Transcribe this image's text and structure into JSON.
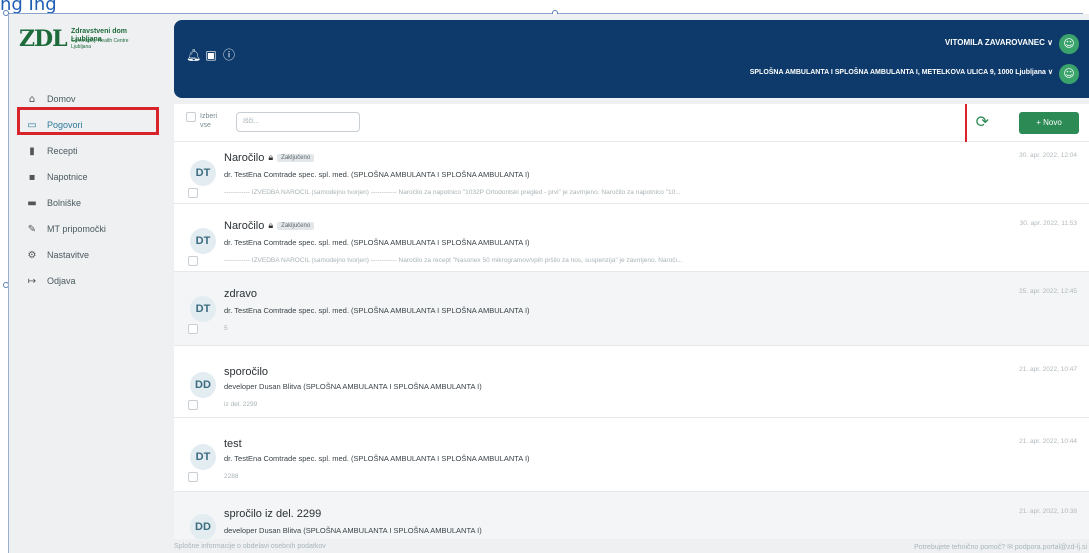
{
  "header_crop": {
    "text": "ng Ing"
  },
  "logo": {
    "mark": "ZDL",
    "name": "Zdravstveni dom Ljubljana",
    "sub": "Community Health Centre Ljubljana"
  },
  "sidebar": {
    "items": [
      {
        "label": "Domov",
        "icon": "home-icon"
      },
      {
        "label": "Pogovori",
        "icon": "chat-icon"
      },
      {
        "label": "Recepti",
        "icon": "prescription-icon"
      },
      {
        "label": "Napotnice",
        "icon": "referral-icon"
      },
      {
        "label": "Bolniške",
        "icon": "bed-icon"
      },
      {
        "label": "MT pripomočki",
        "icon": "tool-icon"
      },
      {
        "label": "Nastavitve",
        "icon": "gear-icon"
      },
      {
        "label": "Odjava",
        "icon": "logout-icon"
      }
    ]
  },
  "topbar": {
    "user": "VITOMILA ZAVAROVANEC ∨",
    "location": "SPLOŠNA AMBULANTA I SPLOŠNA AMBULANTA I, METELKOVA ULICA 9, 1000 Ljubljana ∨"
  },
  "toolbar": {
    "select_all": "Izberi vse",
    "search_placeholder": "Išči...",
    "new_label": "+ Novo"
  },
  "messages": [
    {
      "initials": "DT",
      "title": "Naročilo",
      "locked": true,
      "badge": "Zaključeno",
      "sender": "dr. TestEna Comtrade spec. spl. med. (SPLOŠNA AMBULANTA I SPLOŠNA AMBULANTA I)",
      "preview": "------------ IZVEDBA NAROČIL (samodejno tvorjen) ------------ Naročilo za napotnico \"1032P Ortodontski pregled - prvi\" je zavrnjeno. Naročilo za napotnico \"10...",
      "date": "30. apr. 2022, 12:04"
    },
    {
      "initials": "DT",
      "title": "Naročilo",
      "locked": true,
      "badge": "Zaključeno",
      "sender": "dr. TestEna Comtrade spec. spl. med. (SPLOŠNA AMBULANTA I SPLOŠNA AMBULANTA I)",
      "preview": "------------ IZVEDBA NAROČIL (samodejno tvorjen) ------------ Naročilo za recept \"Nasonex 50 mikrogramov/vpih pršilo za nos, suspenzija\" je zavrnjeno. Naroči...",
      "date": "30. apr. 2022, 11:53"
    },
    {
      "initials": "DT",
      "title": "zdravo",
      "locked": false,
      "badge": "",
      "sender": "dr. TestEna Comtrade spec. spl. med. (SPLOŠNA AMBULANTA I SPLOŠNA AMBULANTA I)",
      "preview": "5",
      "date": "25. apr. 2022, 12:45"
    },
    {
      "initials": "DD",
      "title": "sporočilo",
      "locked": false,
      "badge": "",
      "sender": "developer Dusan Blitva (SPLOŠNA AMBULANTA I SPLOŠNA AMBULANTA I)",
      "preview": "iz del. 2299",
      "date": "21. apr. 2022, 10:47"
    },
    {
      "initials": "DT",
      "title": "test",
      "locked": false,
      "badge": "",
      "sender": "dr. TestEna Comtrade spec. spl. med. (SPLOŠNA AMBULANTA I SPLOŠNA AMBULANTA I)",
      "preview": "2288",
      "date": "21. apr. 2022, 10:44"
    },
    {
      "initials": "DD",
      "title": "spročilo iz del. 2299",
      "locked": false,
      "badge": "",
      "sender": "developer Dusan Blitva (SPLOŠNA AMBULANTA I SPLOŠNA AMBULANTA I)",
      "preview": "",
      "date": "21. apr. 2022, 10:38"
    }
  ],
  "footer": {
    "left": "Splošne informacije o obdelavi osebnih podatkov",
    "right": "Potrebujete tehnično pomoč? ✉ podpora.portal@zd-lj.si"
  },
  "colors": {
    "navy": "#0d3a6a",
    "green": "#2c8a55",
    "highlight": "#d8232a"
  }
}
